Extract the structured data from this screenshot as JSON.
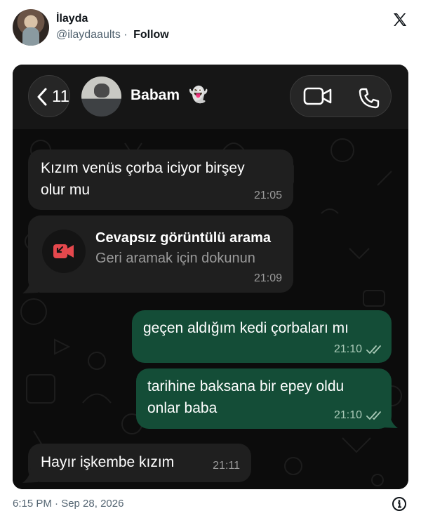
{
  "tweet": {
    "author_name": "İlayda",
    "author_handle": "@ilaydaaults",
    "separator": "·",
    "follow_label": "Follow",
    "timestamp": "6:15 PM · Sep 28, 2026"
  },
  "chat": {
    "back_count": "11",
    "contact_name": "Babam",
    "contact_emoji": "👻",
    "messages": [
      {
        "dir": "in",
        "lines": [
          "Kızım venüs çorba iciyor birşey",
          "olur mu"
        ],
        "time": "21:05"
      },
      {
        "dir": "in",
        "type": "missed_call",
        "title": "Cevapsız görüntülü arama",
        "subtitle": "Geri aramak için dokunun",
        "time": "21:09"
      },
      {
        "dir": "out",
        "lines": [
          "geçen aldığım kedi çorbaları mı"
        ],
        "time": "21:10",
        "status": "read"
      },
      {
        "dir": "out",
        "lines": [
          "tarihine baksana bir epey oldu",
          "onlar baba"
        ],
        "time": "21:10",
        "status": "read"
      },
      {
        "dir": "in",
        "lines": [
          "Hayır işkembe kızım"
        ],
        "time": "21:11"
      }
    ]
  },
  "colors": {
    "incoming_bubble": "#1f1f1f",
    "outgoing_bubble": "#144d37",
    "missed_call_red": "#e5484d",
    "chat_background": "#0c0c0c"
  },
  "icons": {
    "x_logo": "x-logo-icon",
    "back": "chevron-left-icon",
    "video": "video-camera-icon",
    "phone": "phone-icon",
    "missed_call": "missed-video-call-icon",
    "read": "double-check-icon",
    "info": "info-icon"
  }
}
